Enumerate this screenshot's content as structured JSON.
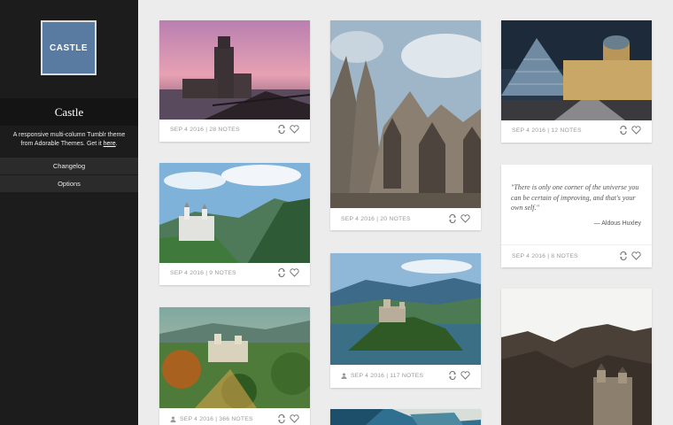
{
  "sidebar": {
    "logo_text": "CASTLE",
    "blog_title": "Castle",
    "description": "A responsive multi-column Tumblr theme from Adorable Themes. Get it",
    "description_link": "here",
    "description_end": ".",
    "nav": [
      "Changelog",
      "Options"
    ]
  },
  "posts": [
    {
      "meta": "SEP 4 2016 | 28 NOTES"
    },
    {
      "meta": "SEP 4 2016 | 9 NOTES"
    },
    {
      "meta": "SEP 4 2016 | 366 NOTES"
    },
    {
      "meta": "SEP 4 2016 | 20 NOTES"
    },
    {
      "meta": "SEP 4 2016 | 117 NOTES"
    },
    {
      "meta": "SEP 4 2016 | 12 NOTES"
    },
    {
      "meta": "SEP 4 2016 | 8 NOTES"
    }
  ],
  "quote": {
    "text": "\"There is only one corner of the universe you can be certain of improving, and that's your own self.\"",
    "source": "— Aldous Huxley"
  },
  "icons": {
    "reblog": "reblog-icon",
    "like": "heart-icon",
    "author": "user-icon"
  },
  "colors": {
    "sidebar": "#1c1c1c",
    "logo": "#5a7ba1",
    "page": "#ececec"
  }
}
